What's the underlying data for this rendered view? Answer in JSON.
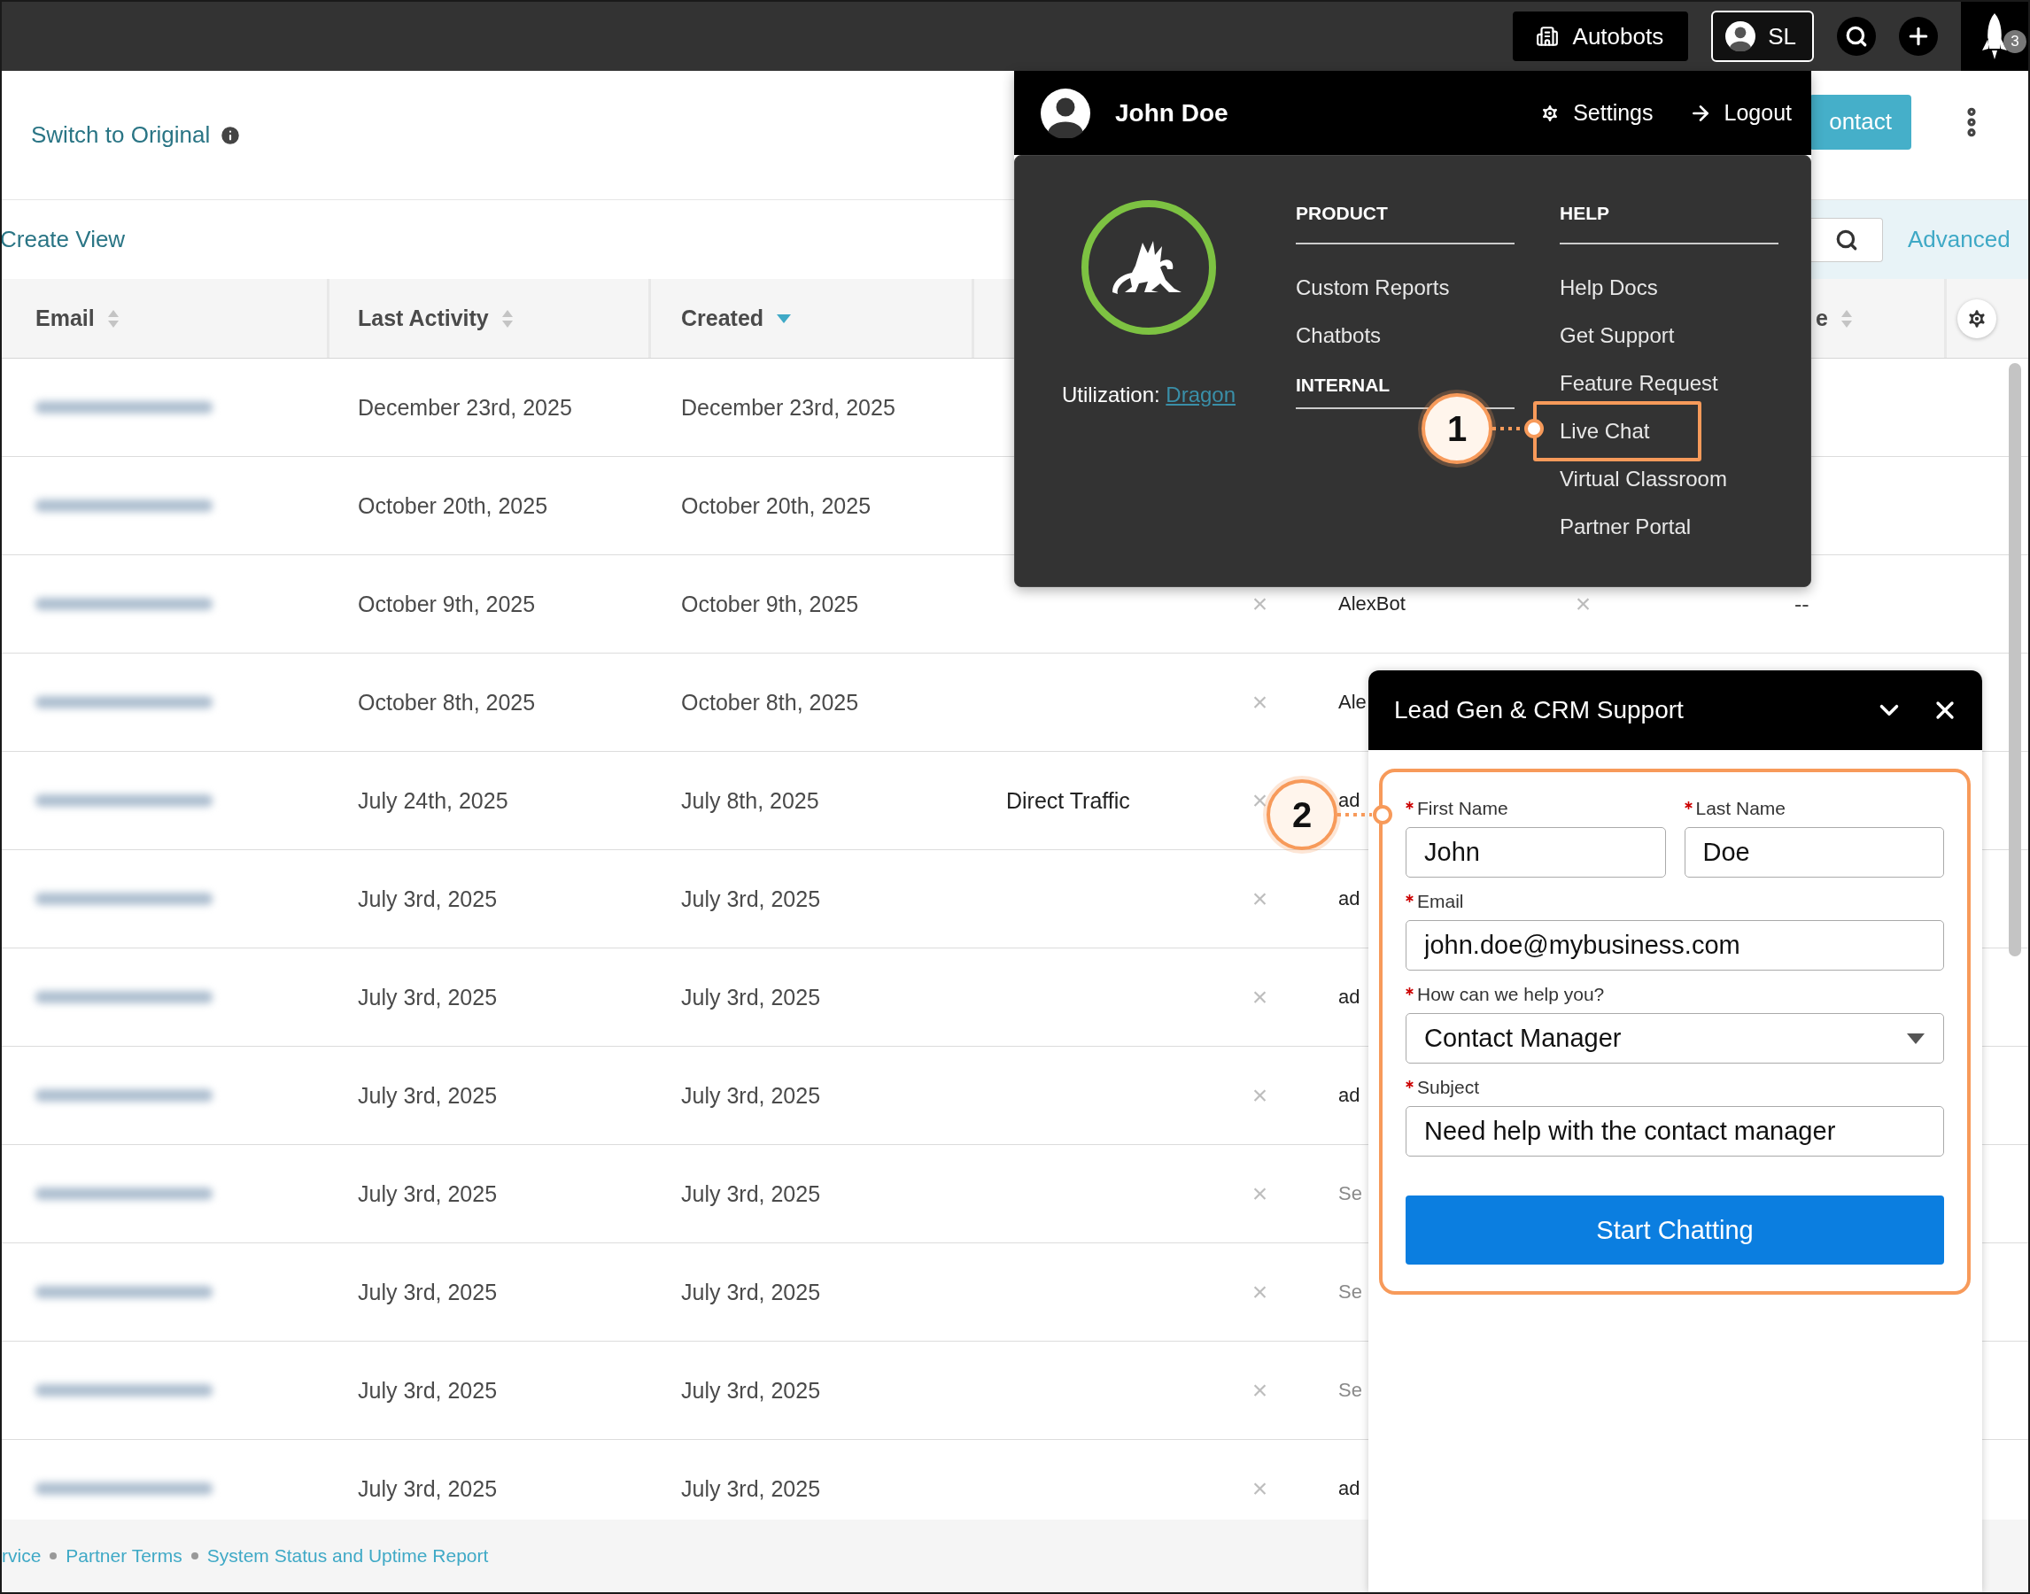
{
  "top_bar": {
    "account_button": "Autobots",
    "user_button": "SL",
    "notification_count": "3"
  },
  "page_header": {
    "switch_link": "Switch to Original",
    "contact_button": "ontact"
  },
  "toolbar": {
    "create_view_link": "Create View",
    "advanced_link": "Advanced"
  },
  "table": {
    "columns": [
      {
        "kind": "sortable",
        "label": "Email",
        "sorted": false
      },
      {
        "kind": "sortable",
        "label": "Last Activity",
        "sorted": false
      },
      {
        "kind": "sortable",
        "label": "Created",
        "sorted": true
      },
      {
        "kind": "hidden"
      },
      {
        "kind": "hidden"
      },
      {
        "kind": "hidden"
      },
      {
        "kind": "hidden"
      },
      {
        "kind": "hidden"
      },
      {
        "kind": "sortable",
        "label": "e",
        "sorted": false
      },
      {
        "kind": "settings"
      }
    ],
    "rows": [
      {
        "email_redacted": true,
        "last_activity": "December 23rd, 2025",
        "created": "December 23rd, 2025"
      },
      {
        "email_redacted": true,
        "last_activity": "October 20th, 2025",
        "created": "October 20th, 2025"
      },
      {
        "email_redacted": true,
        "last_activity": "October 9th, 2025",
        "created": "October 9th, 2025",
        "column_5": "×",
        "column_6": {
          "text": "AlexBot",
          "muted": false
        },
        "column_7": "×",
        "column_9": "--"
      },
      {
        "email_redacted": true,
        "last_activity": "October 8th, 2025",
        "created": "October 8th, 2025",
        "column_5": "×",
        "column_6": {
          "text": "Ale",
          "muted": false
        }
      },
      {
        "email_redacted": true,
        "last_activity": "July 24th, 2025",
        "created": "July 8th, 2025",
        "column_4": "Direct Traffic",
        "column_5": "×",
        "column_6": {
          "text": "ad",
          "muted": false
        }
      },
      {
        "email_redacted": true,
        "last_activity": "July 3rd, 2025",
        "created": "July 3rd, 2025",
        "column_5": "×",
        "column_6": {
          "text": "ad",
          "muted": false
        }
      },
      {
        "email_redacted": true,
        "last_activity": "July 3rd, 2025",
        "created": "July 3rd, 2025",
        "column_5": "×",
        "column_6": {
          "text": "ad",
          "muted": false
        }
      },
      {
        "email_redacted": true,
        "last_activity": "July 3rd, 2025",
        "created": "July 3rd, 2025",
        "column_5": "×",
        "column_6": {
          "text": "ad",
          "muted": false
        }
      },
      {
        "email_redacted": true,
        "last_activity": "July 3rd, 2025",
        "created": "July 3rd, 2025",
        "column_5": "×",
        "column_6": {
          "text": "Se",
          "muted": true
        }
      },
      {
        "email_redacted": true,
        "last_activity": "July 3rd, 2025",
        "created": "July 3rd, 2025",
        "column_5": "×",
        "column_6": {
          "text": "Se",
          "muted": true
        }
      },
      {
        "email_redacted": true,
        "last_activity": "July 3rd, 2025",
        "created": "July 3rd, 2025",
        "column_5": "×",
        "column_6": {
          "text": "Se",
          "muted": true
        }
      },
      {
        "email_redacted": true,
        "last_activity": "July 3rd, 2025",
        "created": "July 3rd, 2025",
        "column_5": "×",
        "column_6": {
          "text": "ad",
          "muted": false
        }
      }
    ]
  },
  "footer": {
    "links": [
      "rvice",
      "Partner Terms",
      "System Status and Uptime Report"
    ]
  },
  "user_menu": {
    "name": "John Doe",
    "settings": "Settings",
    "logout": "Logout",
    "utilization_label": "Utilization:",
    "utilization_link": "Dragon",
    "product": {
      "heading": "PRODUCT",
      "items": [
        {
          "label": "Custom Reports",
          "highlighted": false
        },
        {
          "label": "Chatbots",
          "highlighted": false
        }
      ]
    },
    "internal_heading": "INTERNAL",
    "help": {
      "heading": "HELP",
      "items": [
        {
          "label": "Help Docs",
          "highlighted": false
        },
        {
          "label": "Get Support",
          "highlighted": false
        },
        {
          "label": "Feature Request",
          "highlighted": false
        },
        {
          "label": "Live Chat",
          "highlighted": true
        },
        {
          "label": "Virtual Classroom",
          "highlighted": false
        },
        {
          "label": "Partner Portal",
          "highlighted": false
        }
      ]
    }
  },
  "chat_widget": {
    "title": "Lead Gen & CRM Support",
    "highlighted": true,
    "fields": [
      {
        "kind": "text",
        "label": "First Name",
        "required": true,
        "value": "John"
      },
      {
        "kind": "text",
        "label": "Last Name",
        "required": true,
        "value": "Doe"
      },
      {
        "kind": "text",
        "label": "Email",
        "required": true,
        "value": "john.doe@mybusiness.com"
      },
      {
        "kind": "select",
        "label": "How can we help you?",
        "required": true,
        "value": "Contact Manager"
      },
      {
        "kind": "text",
        "label": "Subject",
        "required": true,
        "value": "Need help with the contact manager"
      }
    ],
    "button": "Start Chatting"
  },
  "annotations": [
    {
      "number": "1"
    },
    {
      "number": "2"
    }
  ]
}
